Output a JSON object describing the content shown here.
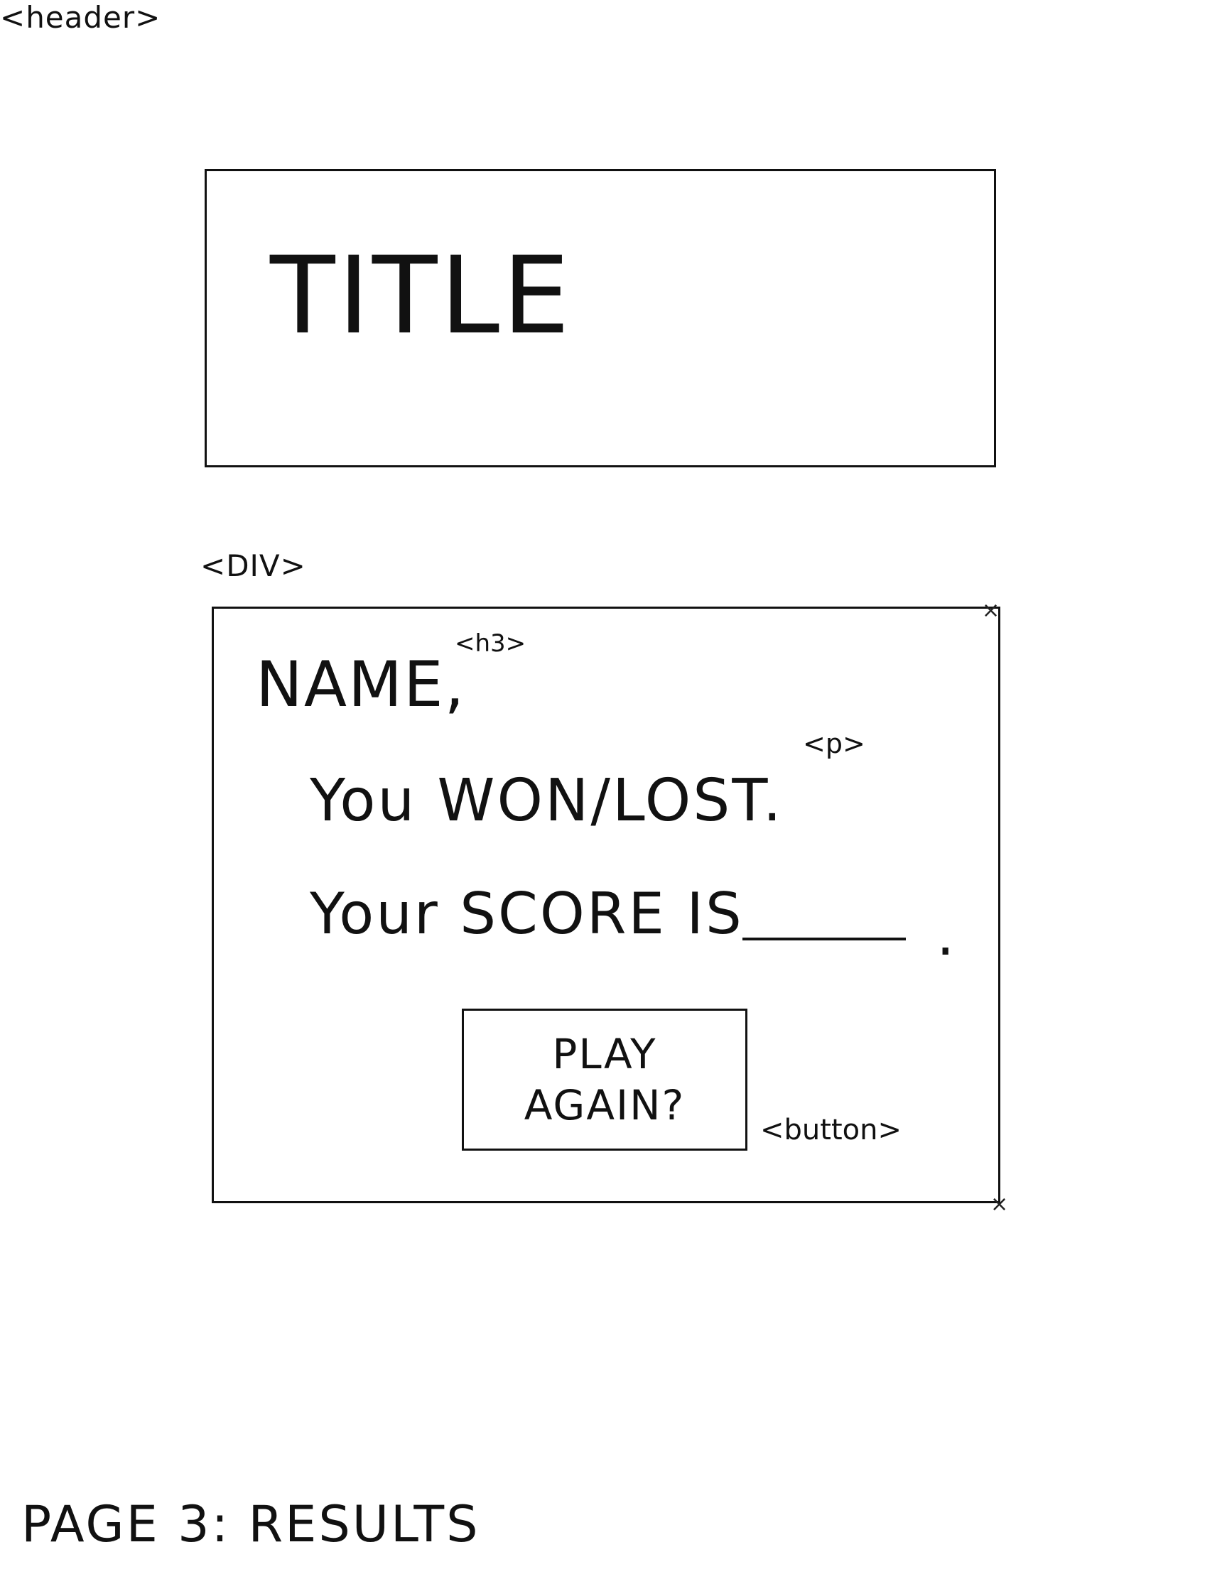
{
  "header": {
    "tag": "<header>",
    "title": "TITLE"
  },
  "result_div": {
    "tag": "<DIV>",
    "name": {
      "tag": "<h3>",
      "text": "NAME,"
    },
    "message": {
      "tag": "<p>",
      "won_lost": "You WON/LOST.",
      "score": "Your SCORE IS",
      "period": "."
    },
    "button": {
      "tag": "<button>",
      "label": "PLAY\nAGAIN?"
    }
  },
  "page_label": "PAGE 3: RESULTS"
}
